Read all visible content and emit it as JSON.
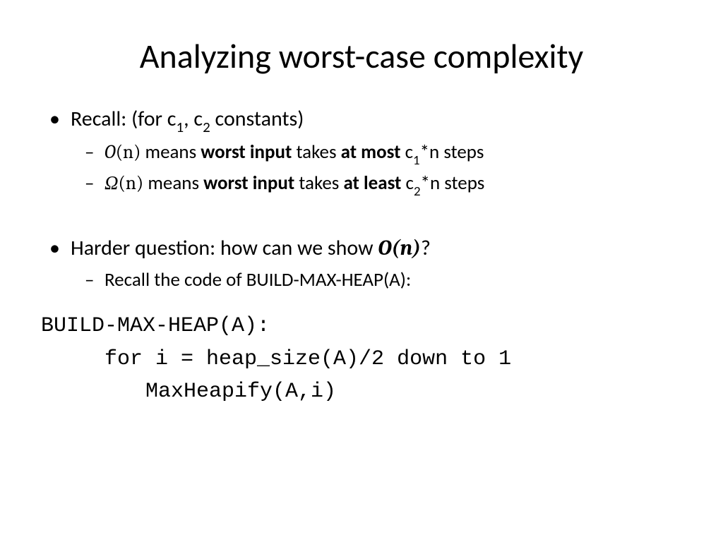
{
  "title": "Analyzing worst-case complexity",
  "bullet1": {
    "prefix": "Recall: (for c",
    "sub1": "1",
    "mid": ", c",
    "sub2": "2",
    "suffix": " constants)"
  },
  "sub1a": {
    "oOpen": "O",
    "nParen": "(n)",
    "t1": " means ",
    "b1": "worst input",
    "t2": " takes ",
    "b2": "at most",
    "t3": " c",
    "sub": "1",
    "t4": "*n steps"
  },
  "sub1b": {
    "omega": "Ω",
    "nParen": "(n)",
    "t1": " means ",
    "b1": "worst input",
    "t2": " takes ",
    "b2": "at least",
    "t3": " c",
    "sub": "2",
    "t4": "*n steps"
  },
  "bullet2": {
    "t1": "Harder question: how can we show ",
    "math": "O(n)",
    "t2": "?"
  },
  "sub2a": "Recall the code of BUILD-MAX-HEAP(A):",
  "code": {
    "line1": "BUILD-MAX-HEAP(A):",
    "line2": "for i = heap_size(A)/2 down to 1",
    "line3": "MaxHeapify(A,i)"
  }
}
